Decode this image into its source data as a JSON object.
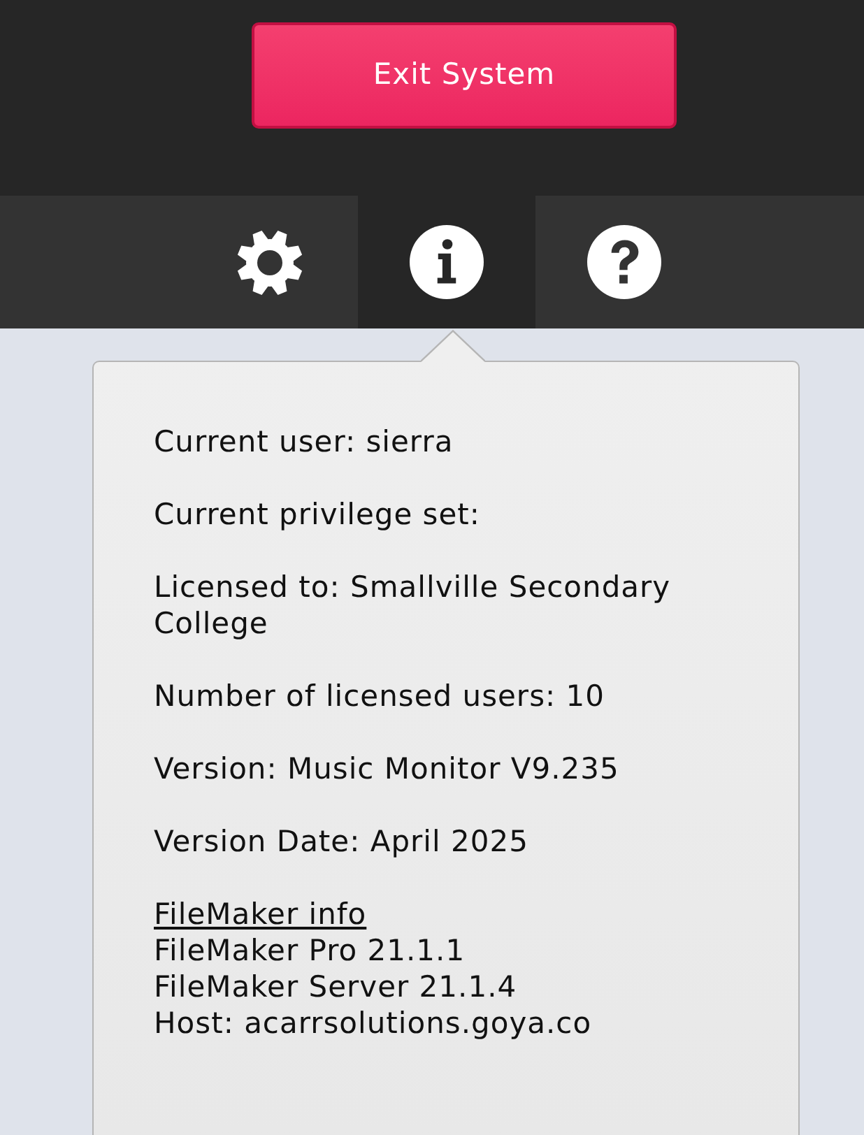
{
  "header": {
    "exit_button": "Exit System"
  },
  "tabs": [
    {
      "kind": "settings",
      "selected": false
    },
    {
      "kind": "info",
      "selected": true
    },
    {
      "kind": "help",
      "selected": false
    }
  ],
  "info_panel": {
    "lines": [
      "Current user: sierra",
      "Current privilege set:",
      "Licensed to: Smallville Secondary College",
      "Number of licensed users: 10",
      "Version: Music Monitor V9.235",
      "Version Date: April 2025"
    ],
    "filemaker": {
      "heading": "FileMaker info",
      "lines": [
        "FileMaker Pro 21.1.1",
        "FileMaker Server 21.1.4",
        "Host: acarrsolutions.goya.co"
      ]
    }
  }
}
